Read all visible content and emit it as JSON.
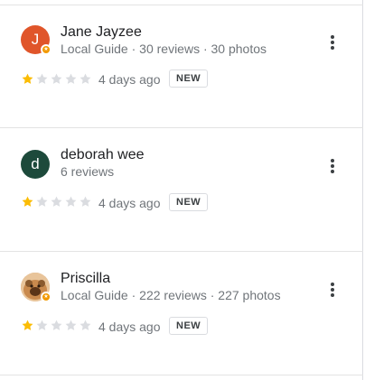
{
  "colors": {
    "star_filled": "#fbbc04",
    "star_empty": "#dadce0",
    "guide_badge": "#f29900"
  },
  "reviews": [
    {
      "name": "Jane Jayzee",
      "meta": "Local Guide · 30 reviews · 30 photos",
      "avatar_letter": "J",
      "avatar_color": "#e0552a",
      "local_guide": true,
      "rating": 1,
      "max_rating": 5,
      "date": "4 days ago",
      "badge": "NEW"
    },
    {
      "name": "deborah wee",
      "meta": "6 reviews",
      "avatar_letter": "d",
      "avatar_color": "#1d4a3b",
      "local_guide": false,
      "rating": 1,
      "max_rating": 5,
      "date": "4 days ago",
      "badge": "NEW"
    },
    {
      "name": "Priscilla",
      "meta": "Local Guide · 222 reviews · 227 photos",
      "avatar_letter": "",
      "avatar_color": "#e3b07a",
      "local_guide": true,
      "rating": 1,
      "max_rating": 5,
      "date": "4 days ago",
      "badge": "NEW"
    }
  ]
}
